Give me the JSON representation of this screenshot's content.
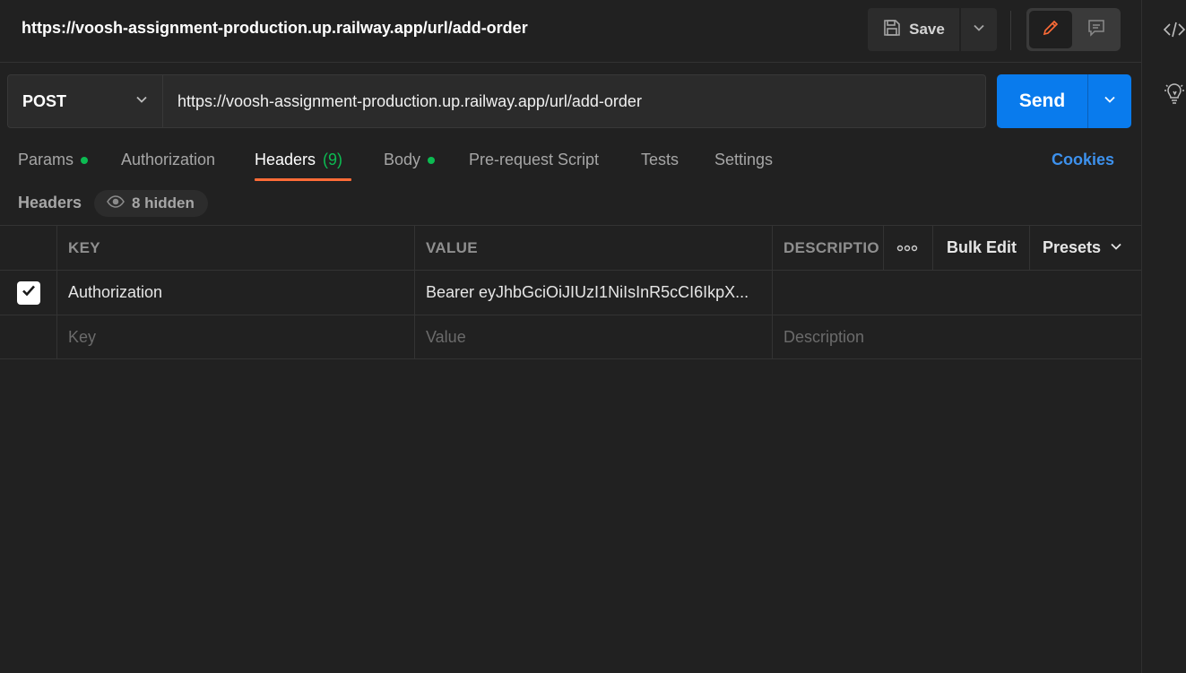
{
  "request": {
    "title": "https://voosh-assignment-production.up.railway.app/url/add-order",
    "method": "POST",
    "url": "https://voosh-assignment-production.up.railway.app/url/add-order"
  },
  "toolbar": {
    "save_label": "Save",
    "send_label": "Send"
  },
  "tabs": [
    {
      "label": "Params",
      "dot": true
    },
    {
      "label": "Authorization"
    },
    {
      "label": "Headers",
      "count": "(9)",
      "active": true
    },
    {
      "label": "Body",
      "dot": true
    },
    {
      "label": "Pre-request Script"
    },
    {
      "label": "Tests"
    },
    {
      "label": "Settings"
    }
  ],
  "cookies_label": "Cookies",
  "headers_section": {
    "label": "Headers",
    "hidden_label": "8 hidden"
  },
  "table": {
    "columns": [
      "KEY",
      "VALUE",
      "DESCRIPTIO"
    ],
    "more_label": "ooo",
    "bulk_edit": "Bulk Edit",
    "presets": "Presets",
    "rows": [
      {
        "checked": true,
        "key": "Authorization",
        "value": "Bearer eyJhbGciOiJIUzI1NiIsInR5cCI6IkpX...",
        "description": ""
      }
    ],
    "placeholders": {
      "key": "Key",
      "value": "Value",
      "description": "Description"
    }
  },
  "colors": {
    "accent_orange": "#ff6c37",
    "send_blue": "#097bed",
    "status_green": "#0cbb52",
    "link_blue": "#3d91ed"
  },
  "icons": [
    "save-icon",
    "chevron-down-icon",
    "pencil-icon",
    "comment-icon",
    "code-icon",
    "lightbulb-icon",
    "eye-icon",
    "checkmark-icon"
  ]
}
